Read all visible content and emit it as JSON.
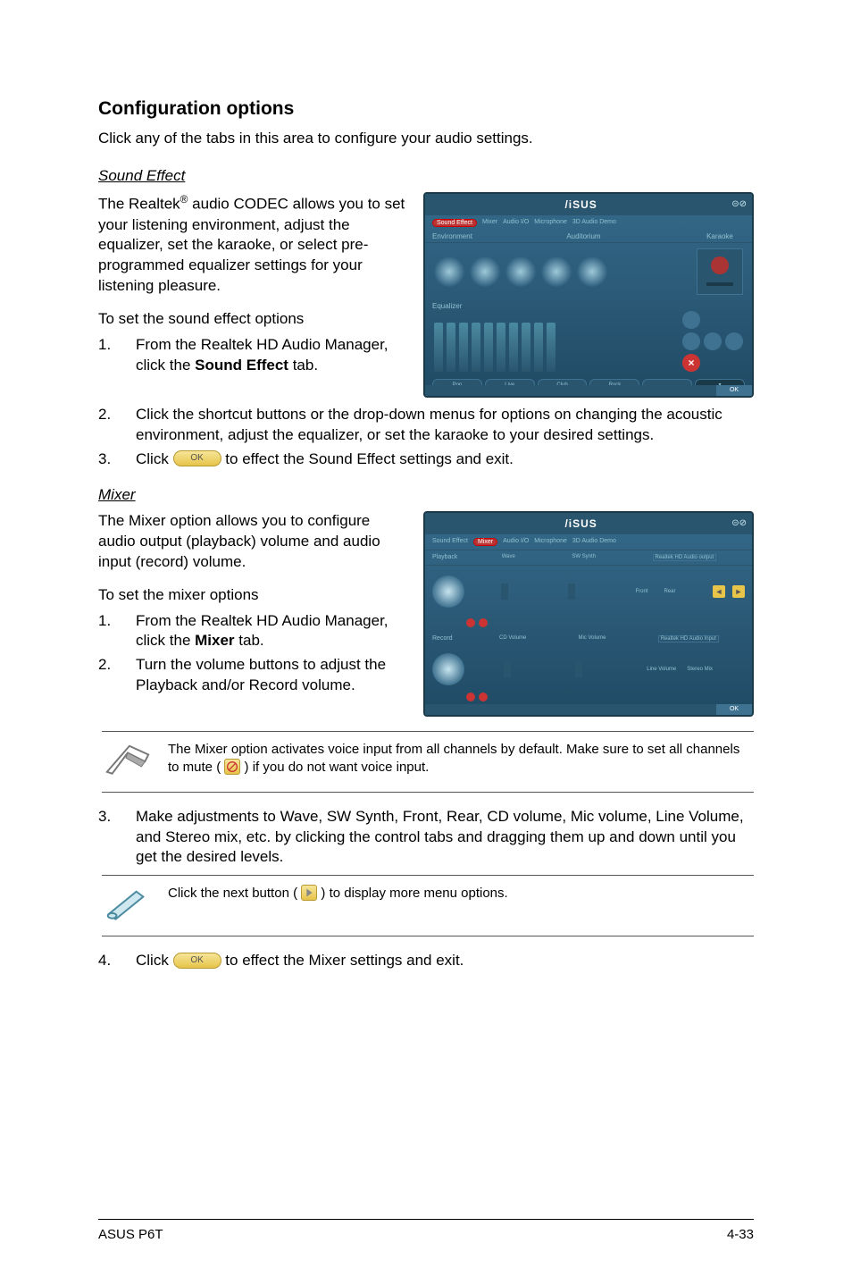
{
  "heading": "Configuration options",
  "intro": "Click any of the tabs in this area to configure your audio settings.",
  "sound_effect": {
    "title": "Sound Effect",
    "para1_pre": "The Realtek",
    "para1_post": " audio CODEC allows you to set your listening environment, adjust the equalizer, set the karaoke, or select pre-programmed equalizer settings for your listening pleasure.",
    "para2": "To set the sound effect options",
    "steps_a": {
      "n1": "1.",
      "t1_pre": "From the Realtek HD Audio Manager, click the ",
      "t1_bold": "Sound Effect",
      "t1_post": " tab."
    },
    "steps_b": {
      "n2": "2.",
      "t2": "Click the shortcut buttons or the drop-down menus for options on changing the acoustic environment, adjust the equalizer, or set the karaoke to your desired settings.",
      "n3": "3.",
      "t3_pre": "Click ",
      "t3_post": " to effect the Sound Effect settings and exit."
    }
  },
  "mixer": {
    "title": "Mixer",
    "para1": "The Mixer option allows you to configure audio output (playback) volume and audio input (record) volume.",
    "para2": "To set the mixer options",
    "steps_a": {
      "n1": "1.",
      "t1_pre": "From the Realtek HD Audio Manager, click the ",
      "t1_bold": "Mixer",
      "t1_post": " tab.",
      "n2": "2.",
      "t2": "Turn the volume buttons to adjust the Playback and/or Record volume."
    },
    "note1_pre": "The Mixer option activates voice input from all channels by default. Make sure to set all channels to mute (",
    "note1_post": ") if you do not want voice input.",
    "step3": {
      "n3": "3.",
      "t3": "Make adjustments to Wave, SW Synth, Front, Rear, CD volume, Mic volume, Line Volume, and Stereo mix, etc. by clicking the control tabs and dragging them up and down until you get the desired levels."
    },
    "note2_pre": "Click the next button (",
    "note2_post": ") to display more menu options.",
    "step4": {
      "n4": "4.",
      "t4_pre": "Click ",
      "t4_post": " to effect the Mixer settings and exit."
    }
  },
  "ok_label": "OK",
  "ss1": {
    "logo": "/iSUS",
    "tabs": [
      "Sound Effect",
      "Mixer",
      "Audio I/O",
      "Microphone",
      "3D Audio Demo"
    ],
    "row1": "Environment",
    "row1b": "Auditorium",
    "row1c": "Karaoke",
    "row2": "Equalizer",
    "btns": [
      "Pop",
      "Live",
      "Club",
      "Rock",
      ""
    ]
  },
  "ss2": {
    "logo": "/iSUS",
    "tabs": [
      "Sound Effect",
      "Mixer",
      "Audio I/O",
      "Microphone",
      "3D Audio Demo"
    ],
    "playback": "Playback",
    "record": "Record",
    "cols_pb": [
      "Wave",
      "SW Synth"
    ],
    "pb_out": "Realtek HD Audio output",
    "pb_front": "Front",
    "pb_rear": "Rear",
    "cols_rec": [
      "CD Volume",
      "Mic Volume"
    ],
    "rec_in": "Realtek HD Audio Input",
    "rec_line": "Line Volume",
    "rec_stereo": "Stereo Mix"
  },
  "footer": {
    "left": "ASUS P6T",
    "right": "4-33"
  }
}
